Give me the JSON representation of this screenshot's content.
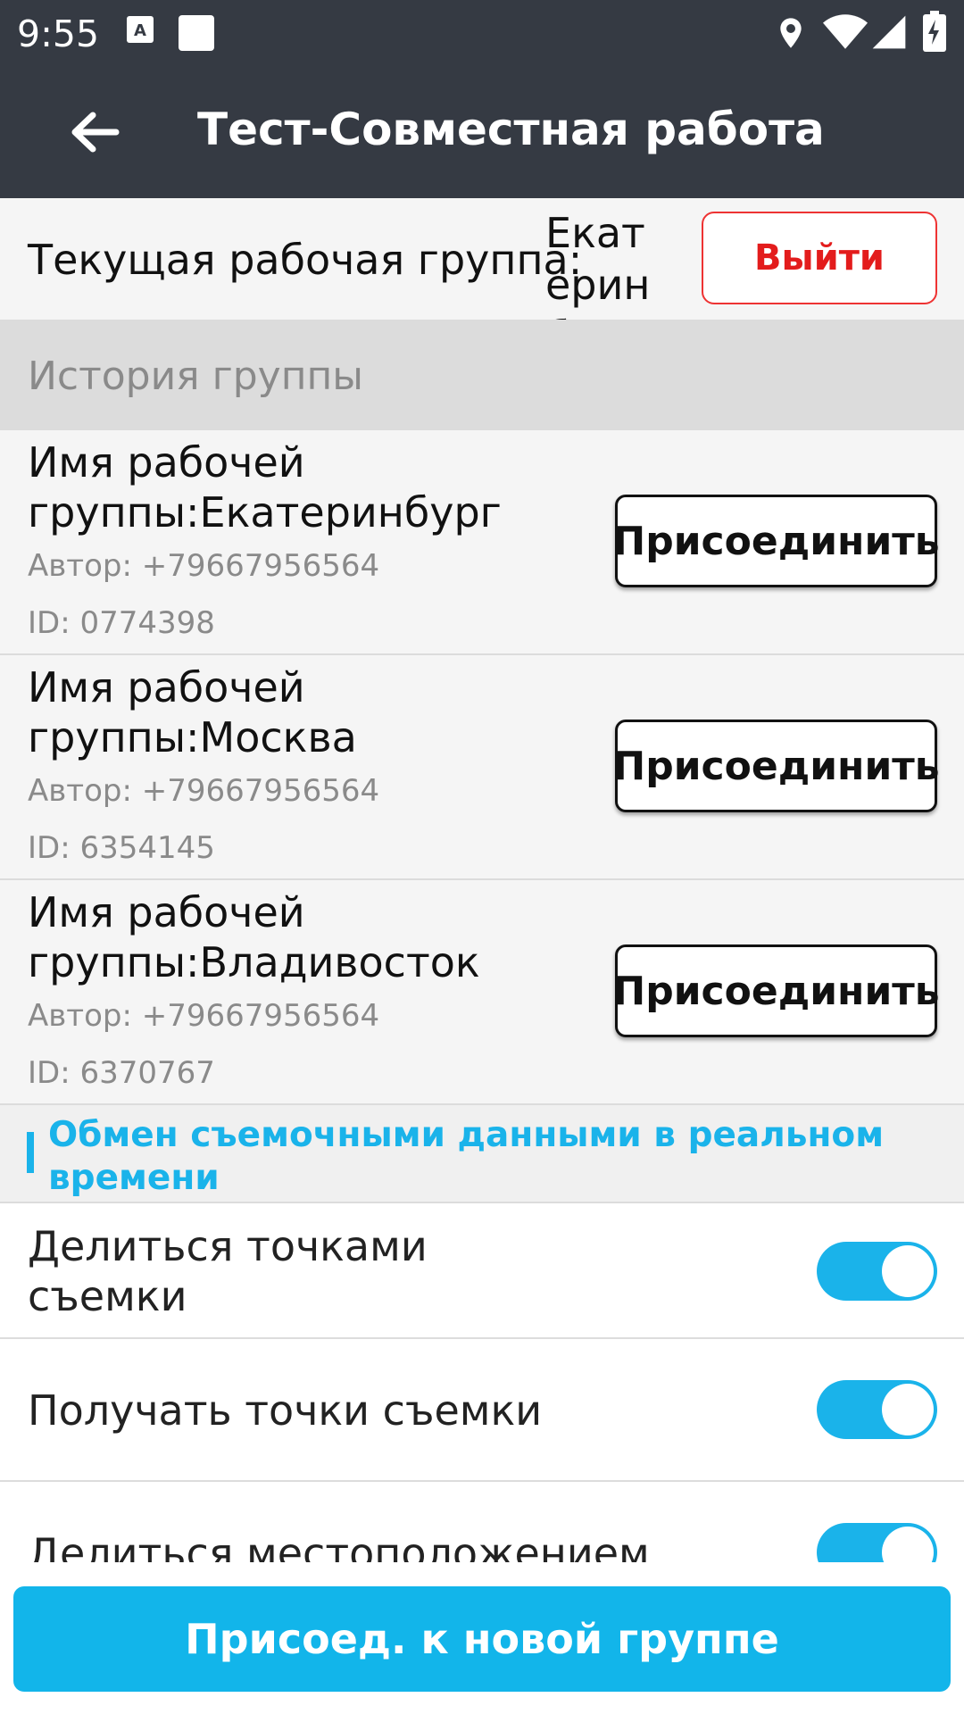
{
  "status_bar": {
    "time": "9:55",
    "icons": [
      "a-notification-icon",
      "square-notification-icon",
      "location-icon",
      "wifi-icon",
      "signal-icon",
      "battery-charging-icon"
    ]
  },
  "app_bar": {
    "title": "Тест-Совместная работа",
    "back_icon": "arrow-left-icon"
  },
  "current_group": {
    "label": "Текущая рабочая группа:",
    "value": "Екатеринбу",
    "exit_label": "Выйти"
  },
  "history": {
    "title": "История группы",
    "items": [
      {
        "name": "Имя рабочей группы:Екатеринбург",
        "author": "Автор: +79667956564",
        "id": "ID: 0774398",
        "join_label": "Присоединить"
      },
      {
        "name": "Имя рабочей группы:Москва",
        "author": "Автор: +79667956564",
        "id": "ID: 6354145",
        "join_label": "Присоединить"
      },
      {
        "name": "Имя рабочей группы:Владивосток",
        "author": "Автор: +79667956564",
        "id": "ID: 6370767",
        "join_label": "Присоединить"
      }
    ]
  },
  "realtime": {
    "title": "Обмен съемочными данными в реальном времени",
    "toggles": [
      {
        "label": "Делиться точками съемки",
        "on": true
      },
      {
        "label": "Получать точки съемки",
        "on": true
      },
      {
        "label": "Делиться местоположением",
        "on": true
      }
    ]
  },
  "bottom": {
    "join_new_label": "Присоед. к новой группе"
  },
  "colors": {
    "bar": "#353a43",
    "accent": "#1ab3ea",
    "exit": "#e31c1c"
  }
}
